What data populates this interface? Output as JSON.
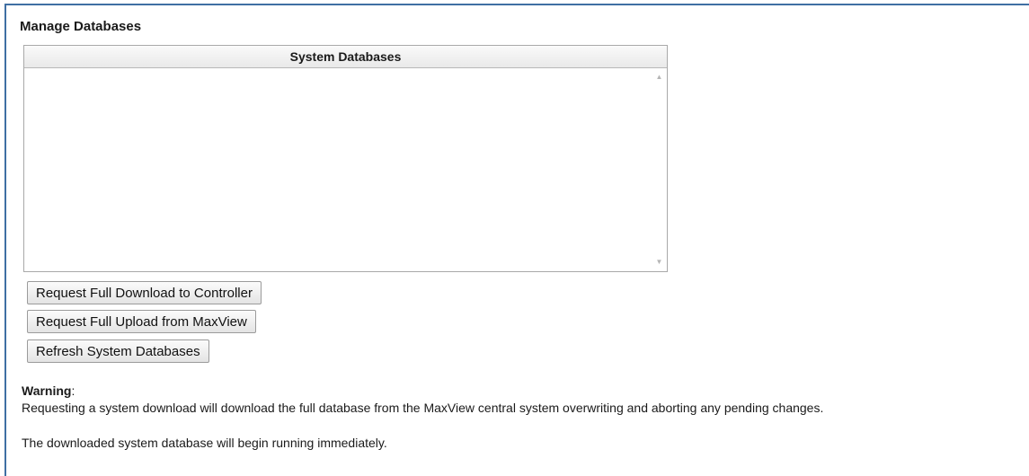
{
  "page": {
    "title": "Manage Databases"
  },
  "databases_panel": {
    "header": "System Databases",
    "items": []
  },
  "buttons": {
    "request_download": "Request Full Download to Controller",
    "request_upload": "Request Full Upload from MaxView",
    "refresh": "Refresh System Databases"
  },
  "warning": {
    "label": "Warning",
    "colon": ":",
    "message": "Requesting a system download will download the full database from the MaxView central system overwriting and aborting any pending changes.",
    "note": "The downloaded system database will begin running immediately."
  },
  "icons": {
    "scroll_up": "scroll-up-icon",
    "scroll_down": "scroll-down-icon"
  },
  "colors": {
    "frame_border": "#3f6fa3",
    "panel_border": "#a9a9a9",
    "header_bg": "#efefef"
  }
}
